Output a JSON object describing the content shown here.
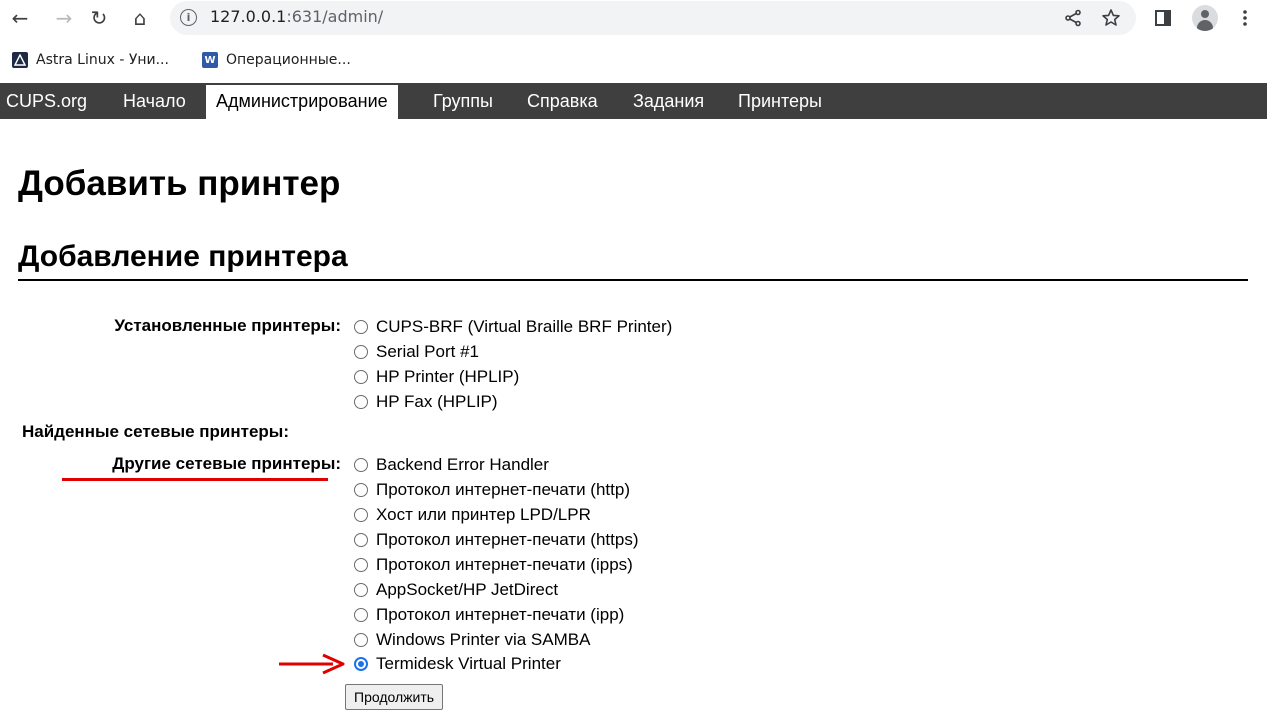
{
  "browser": {
    "url_host": "127.0.0.1",
    "url_rest": ":631/admin/",
    "bookmarks": [
      {
        "label": "Astra Linux - Уни..."
      },
      {
        "label": "Операционные..."
      }
    ]
  },
  "cups_nav": {
    "tabs": [
      {
        "label": "CUPS.org",
        "active": false
      },
      {
        "label": "Начало",
        "active": false
      },
      {
        "label": "Администрирование",
        "active": true
      },
      {
        "label": "Группы",
        "active": false
      },
      {
        "label": "Справка",
        "active": false
      },
      {
        "label": "Задания",
        "active": false
      },
      {
        "label": "Принтеры",
        "active": false
      }
    ]
  },
  "page": {
    "title": "Добавить принтер",
    "subtitle": "Добавление принтера",
    "sections": {
      "installed_label": "Установленные принтеры:",
      "discovered_label": "Найденные сетевые принтеры:",
      "other_label": "Другие сетевые принтеры:"
    },
    "installed_printers": [
      "CUPS-BRF (Virtual Braille BRF Printer)",
      "Serial Port #1",
      "HP Printer (HPLIP)",
      "HP Fax (HPLIP)"
    ],
    "other_printers": [
      "Backend Error Handler",
      "Протокол интернет-печати (http)",
      "Хост или принтер LPD/LPR",
      "Протокол интернет-печати (https)",
      "Протокол интернет-печати (ipps)",
      "AppSocket/HP JetDirect",
      "Протокол интернет-печати (ipp)",
      "Windows Printer via SAMBA",
      "Termidesk Virtual Printer"
    ],
    "selected_printer": "Termidesk Virtual Printer",
    "submit_label": "Продолжить"
  },
  "colors": {
    "nav_bg": "#3f3f3f",
    "annotation": "#e00000",
    "radio_accent": "#1a73e8"
  }
}
